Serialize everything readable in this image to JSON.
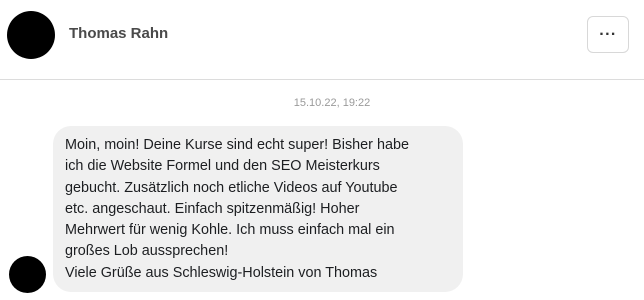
{
  "header": {
    "contact_name": "Thomas Rahn",
    "more_icon": "···"
  },
  "conversation": {
    "timestamp": "15.10.22, 19:22",
    "message": {
      "lines": [
        "Moin, moin! Deine Kurse sind echt super! Bisher habe",
        "ich die Website Formel und den SEO Meisterkurs",
        "gebucht. Zusätzlich noch etliche Videos auf Youtube",
        "etc. angeschaut. Einfach spitzenmäßig! Hoher",
        "Mehrwert für wenig Kohle. Ich muss einfach mal ein",
        "großes Lob aussprechen!",
        "Viele Grüße aus Schleswig-Holstein von Thomas"
      ]
    }
  },
  "colors": {
    "avatar": "#000000",
    "bubble_background": "#f0f0f0",
    "divider": "#dcdcdc",
    "timestamp_text": "#9a9a9a"
  }
}
